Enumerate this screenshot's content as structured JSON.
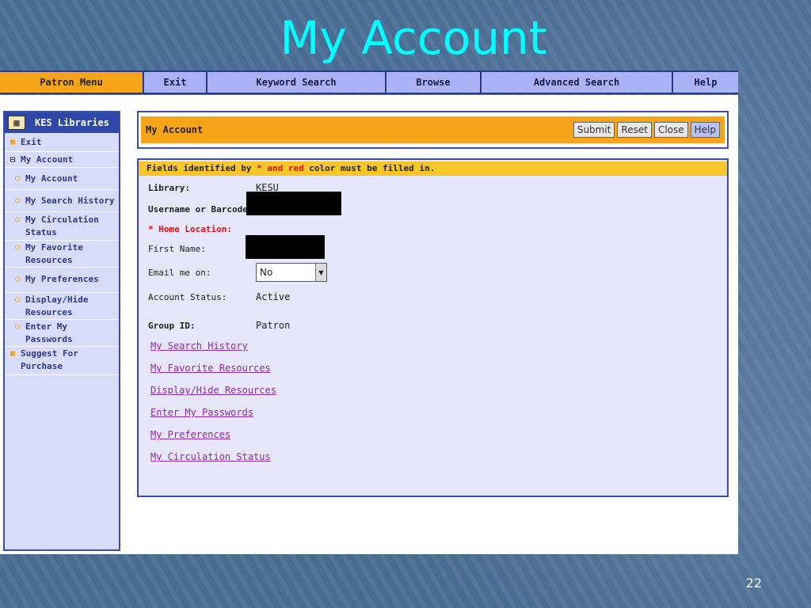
{
  "slide": {
    "title": "My Account",
    "number": "22"
  },
  "menu": [
    {
      "label": "Patron Menu",
      "active": true
    },
    {
      "label": "Exit"
    },
    {
      "label": "Keyword Search"
    },
    {
      "label": "Browse"
    },
    {
      "label": "Advanced Search"
    },
    {
      "label": "Help"
    }
  ],
  "sidebar": {
    "header": "KES Libraries",
    "items": [
      {
        "label": "Exit"
      },
      {
        "label": "My Account"
      },
      {
        "label": "My Account"
      },
      {
        "label": "My Search History"
      },
      {
        "label": "My Circulation Status"
      },
      {
        "label": "My Favorite Resources"
      },
      {
        "label": "My Preferences"
      },
      {
        "label": "Display/Hide Resources"
      },
      {
        "label": "Enter My Passwords"
      },
      {
        "label": "Suggest For Purchase"
      }
    ]
  },
  "panel": {
    "title": "My Account",
    "buttons": {
      "submit": "Submit",
      "reset": "Reset",
      "close": "Close",
      "help": "Help"
    }
  },
  "form": {
    "notice_prefix": "Fields identified by ",
    "notice_red": "* and red",
    "notice_suffix": " color must be filled in.",
    "library_label": "Library:",
    "library_value": "KESU",
    "username_label": "Username or Barcode:",
    "home_location_label": "* Home Location:",
    "first_name_label": "First Name:",
    "email_label": "Email me on:",
    "email_value": "No",
    "account_status_label": "Account Status:",
    "account_status_value": "Active",
    "group_id_label": "Group ID:",
    "group_id_value": "Patron"
  },
  "links": [
    "My Search History",
    "My Favorite Resources",
    "Display/Hide Resources",
    "Enter My Passwords",
    "My Preferences",
    "My Circulation Status"
  ]
}
